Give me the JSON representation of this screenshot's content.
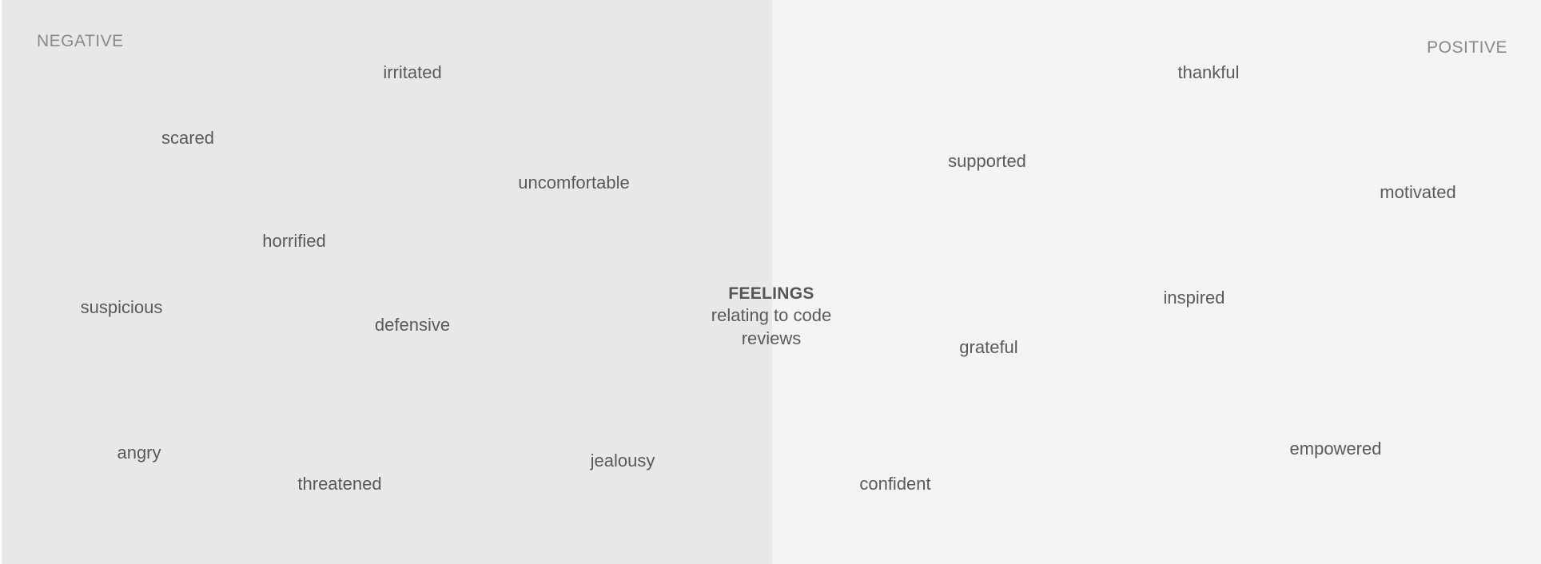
{
  "header": {
    "negative_label": "NEGATIVE",
    "positive_label": "POSITIVE"
  },
  "center": {
    "title": "FEELINGS",
    "subtitle": "relating to code reviews"
  },
  "negative_words": [
    "irritated",
    "scared",
    "uncomfortable",
    "horrified",
    "suspicious",
    "defensive",
    "angry",
    "threatened",
    "jealousy"
  ],
  "positive_words": [
    "thankful",
    "supported",
    "motivated",
    "inspired",
    "grateful",
    "empowered",
    "confident"
  ],
  "colors": {
    "negative_bg": "#e8e8e8",
    "positive_bg": "#f4f4f4",
    "text": "#5a5a5a",
    "side_label": "#8a8a8a"
  }
}
